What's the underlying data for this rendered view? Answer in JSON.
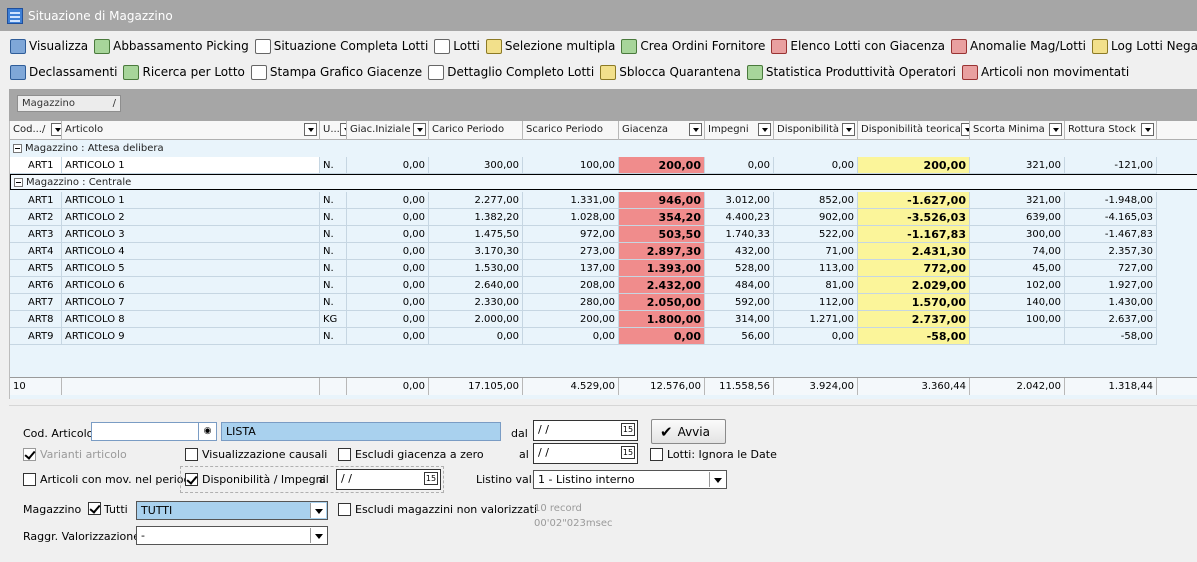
{
  "window": {
    "title": "Situazione di Magazzino"
  },
  "toolbar1": [
    {
      "label": "Visualizza",
      "icon": "grid-icon"
    },
    {
      "label": "Abbassamento Picking",
      "icon": "pick-icon"
    },
    {
      "label": "Situazione Completa Lotti",
      "icon": "table-icon"
    },
    {
      "label": "Lotti",
      "icon": "lots-icon"
    },
    {
      "label": "Selezione multipla",
      "icon": "multi-select-icon"
    },
    {
      "label": "Crea Ordini Fornitore",
      "icon": "order-icon"
    },
    {
      "label": "Elenco Lotti con Giacenza",
      "icon": "stock-lots-icon"
    },
    {
      "label": "Anomalie Mag/Lotti",
      "icon": "anomaly-icon"
    },
    {
      "label": "Log Lotti Negativi",
      "icon": "log-icon"
    }
  ],
  "toolbar2": [
    {
      "label": "Declassamenti",
      "icon": "downgrade-icon"
    },
    {
      "label": "Ricerca per Lotto",
      "icon": "search-lot-icon"
    },
    {
      "label": "Stampa Grafico Giacenze",
      "icon": "print-chart-icon"
    },
    {
      "label": "Dettaglio Completo Lotti",
      "icon": "detail-icon"
    },
    {
      "label": "Sblocca Quarantena",
      "icon": "unlock-icon"
    },
    {
      "label": "Statistica Produttività Operatori",
      "icon": "stats-icon"
    },
    {
      "label": "Articoli non movimentati",
      "icon": "articles-icon"
    }
  ],
  "group_panel": {
    "chip": "Magazzino",
    "chip_sort": "/"
  },
  "columns": [
    "Cod...",
    "Articolo",
    "U...",
    "Giac.Iniziale",
    "Carico Periodo",
    "Scarico Periodo",
    "Giacenza",
    "Impegni",
    "Disponibilità",
    "Disponibilità teorica",
    "Scorta Minima",
    "Rottura Stock"
  ],
  "col_sort": "/",
  "groups": [
    {
      "label": "Magazzino : Attesa delibera",
      "rows": [
        [
          "ART1",
          "ARTICOLO 1",
          "N.",
          "0,00",
          "300,00",
          "100,00",
          "200,00",
          "0,00",
          "0,00",
          "200,00",
          "321,00",
          "-121,00"
        ]
      ]
    },
    {
      "label": "Magazzino : Centrale",
      "rows": [
        [
          "ART1",
          "ARTICOLO 1",
          "N.",
          "0,00",
          "2.277,00",
          "1.331,00",
          "946,00",
          "3.012,00",
          "852,00",
          "-1.627,00",
          "321,00",
          "-1.948,00"
        ],
        [
          "ART2",
          "ARTICOLO 2",
          "N.",
          "0,00",
          "1.382,20",
          "1.028,00",
          "354,20",
          "4.400,23",
          "902,00",
          "-3.526,03",
          "639,00",
          "-4.165,03"
        ],
        [
          "ART3",
          "ARTICOLO 3",
          "N.",
          "0,00",
          "1.475,50",
          "972,00",
          "503,50",
          "1.740,33",
          "522,00",
          "-1.167,83",
          "300,00",
          "-1.467,83"
        ],
        [
          "ART4",
          "ARTICOLO 4",
          "N.",
          "0,00",
          "3.170,30",
          "273,00",
          "2.897,30",
          "432,00",
          "71,00",
          "2.431,30",
          "74,00",
          "2.357,30"
        ],
        [
          "ART5",
          "ARTICOLO 5",
          "N.",
          "0,00",
          "1.530,00",
          "137,00",
          "1.393,00",
          "528,00",
          "113,00",
          "772,00",
          "45,00",
          "727,00"
        ],
        [
          "ART6",
          "ARTICOLO 6",
          "N.",
          "0,00",
          "2.640,00",
          "208,00",
          "2.432,00",
          "484,00",
          "81,00",
          "2.029,00",
          "102,00",
          "1.927,00"
        ],
        [
          "ART7",
          "ARTICOLO 7",
          "N.",
          "0,00",
          "2.330,00",
          "280,00",
          "2.050,00",
          "592,00",
          "112,00",
          "1.570,00",
          "140,00",
          "1.430,00"
        ],
        [
          "ART8",
          "ARTICOLO 8",
          "KG",
          "0,00",
          "2.000,00",
          "200,00",
          "1.800,00",
          "314,00",
          "1.271,00",
          "2.737,00",
          "100,00",
          "2.637,00"
        ],
        [
          "ART9",
          "ARTICOLO 9",
          "N.",
          "0,00",
          "0,00",
          "0,00",
          "0,00",
          "56,00",
          "0,00",
          "-58,00",
          "",
          "-58,00"
        ]
      ]
    }
  ],
  "totals": [
    "10",
    "",
    "",
    "0,00",
    "17.105,00",
    "4.529,00",
    "12.576,00",
    "11.558,56",
    "3.924,00",
    "3.360,44",
    "2.042,00",
    "1.318,44"
  ],
  "filters": {
    "cod_articolo_label": "Cod. Articolo",
    "cod_articolo_value": "",
    "lista_value": "LISTA",
    "dal_label": "dal",
    "dal_value": "/ /",
    "al_label": "al",
    "al_value": "/ /",
    "avvia_label": "Avvia",
    "lotti_ignora_label": "Lotti: Ignora le Date",
    "varianti_label": "Varianti articolo",
    "visual_causali_label": "Visualizzazione causali",
    "escludi_giacenza_label": "Escludi giacenza a zero",
    "articoli_mov_label": "Articoli con mov. nel periodo",
    "disponibilita_label": "Disponibilità / Impegni",
    "disp_al_label": "al",
    "disp_al_value": "/ /",
    "listino_label": "Listino val.",
    "listino_value": "1 - Listino interno",
    "magazzino_label": "Magazzino",
    "tutti_label": "Tutti",
    "magazzino_value": "TUTTI",
    "escludi_magazzini_label": "Escludi magazzini non valorizzati",
    "raggr_label": "Raggr. Valorizzazione",
    "raggr_value": "-",
    "records": "10 record",
    "elapsed": "00'02\"023msec"
  }
}
